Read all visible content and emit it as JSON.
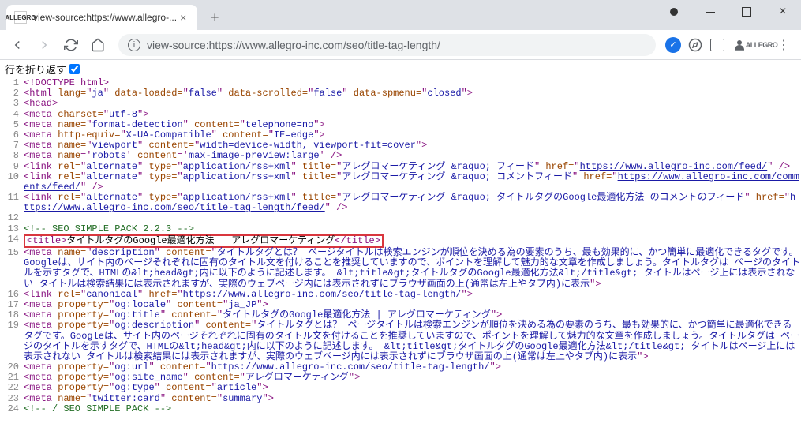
{
  "window": {
    "tab_title": "view-source:https://www.allegro-...",
    "url": "view-source:https://www.allegro-inc.com/seo/title-tag-length/",
    "favicon_text": "ALLEGRO"
  },
  "wrap_label": "行を折り返す",
  "lines": [
    {
      "n": 1,
      "parts": [
        {
          "c": "t",
          "t": "<!DOCTYPE html>"
        }
      ]
    },
    {
      "n": 2,
      "parts": [
        {
          "c": "t",
          "t": "<html "
        },
        {
          "c": "a",
          "t": "lang="
        },
        {
          "c": "t",
          "t": "\""
        },
        {
          "c": "v",
          "t": "ja"
        },
        {
          "c": "t",
          "t": "\" "
        },
        {
          "c": "a",
          "t": "data-loaded="
        },
        {
          "c": "t",
          "t": "\""
        },
        {
          "c": "v",
          "t": "false"
        },
        {
          "c": "t",
          "t": "\" "
        },
        {
          "c": "a",
          "t": "data-scrolled="
        },
        {
          "c": "t",
          "t": "\""
        },
        {
          "c": "v",
          "t": "false"
        },
        {
          "c": "t",
          "t": "\" "
        },
        {
          "c": "a",
          "t": "data-spmenu="
        },
        {
          "c": "t",
          "t": "\""
        },
        {
          "c": "v",
          "t": "closed"
        },
        {
          "c": "t",
          "t": "\">"
        }
      ]
    },
    {
      "n": 3,
      "parts": [
        {
          "c": "t",
          "t": "<head>"
        }
      ]
    },
    {
      "n": 4,
      "parts": [
        {
          "c": "t",
          "t": "<meta "
        },
        {
          "c": "a",
          "t": "charset="
        },
        {
          "c": "t",
          "t": "\""
        },
        {
          "c": "v",
          "t": "utf-8"
        },
        {
          "c": "t",
          "t": "\">"
        }
      ]
    },
    {
      "n": 5,
      "parts": [
        {
          "c": "t",
          "t": "<meta "
        },
        {
          "c": "a",
          "t": "name="
        },
        {
          "c": "t",
          "t": "\""
        },
        {
          "c": "v",
          "t": "format-detection"
        },
        {
          "c": "t",
          "t": "\" "
        },
        {
          "c": "a",
          "t": "content="
        },
        {
          "c": "t",
          "t": "\""
        },
        {
          "c": "v",
          "t": "telephone=no"
        },
        {
          "c": "t",
          "t": "\">"
        }
      ]
    },
    {
      "n": 6,
      "parts": [
        {
          "c": "t",
          "t": "<meta "
        },
        {
          "c": "a",
          "t": "http-equiv="
        },
        {
          "c": "t",
          "t": "\""
        },
        {
          "c": "v",
          "t": "X-UA-Compatible"
        },
        {
          "c": "t",
          "t": "\" "
        },
        {
          "c": "a",
          "t": "content="
        },
        {
          "c": "t",
          "t": "\""
        },
        {
          "c": "v",
          "t": "IE=edge"
        },
        {
          "c": "t",
          "t": "\">"
        }
      ]
    },
    {
      "n": 7,
      "parts": [
        {
          "c": "t",
          "t": "<meta "
        },
        {
          "c": "a",
          "t": "name="
        },
        {
          "c": "t",
          "t": "\""
        },
        {
          "c": "v",
          "t": "viewport"
        },
        {
          "c": "t",
          "t": "\" "
        },
        {
          "c": "a",
          "t": "content="
        },
        {
          "c": "t",
          "t": "\""
        },
        {
          "c": "v",
          "t": "width=device-width, viewport-fit=cover"
        },
        {
          "c": "t",
          "t": "\">"
        }
      ]
    },
    {
      "n": 8,
      "parts": [
        {
          "c": "t",
          "t": "<meta "
        },
        {
          "c": "a",
          "t": "name"
        },
        {
          "c": "t",
          "t": "='"
        },
        {
          "c": "v",
          "t": "robots"
        },
        {
          "c": "t",
          "t": "' "
        },
        {
          "c": "a",
          "t": "content"
        },
        {
          "c": "t",
          "t": "='"
        },
        {
          "c": "v",
          "t": "max-image-preview:large"
        },
        {
          "c": "t",
          "t": "' />"
        }
      ]
    },
    {
      "n": 9,
      "parts": [
        {
          "c": "t",
          "t": "<link "
        },
        {
          "c": "a",
          "t": "rel="
        },
        {
          "c": "t",
          "t": "\""
        },
        {
          "c": "v",
          "t": "alternate"
        },
        {
          "c": "t",
          "t": "\" "
        },
        {
          "c": "a",
          "t": "type="
        },
        {
          "c": "t",
          "t": "\""
        },
        {
          "c": "v",
          "t": "application/rss+xml"
        },
        {
          "c": "t",
          "t": "\" "
        },
        {
          "c": "a",
          "t": "title="
        },
        {
          "c": "t",
          "t": "\""
        },
        {
          "c": "v",
          "t": "アレグロマーケティング &raquo; フィード"
        },
        {
          "c": "t",
          "t": "\" "
        },
        {
          "c": "a",
          "t": "href="
        },
        {
          "c": "t",
          "t": "\""
        },
        {
          "c": "lk",
          "t": "https://www.allegro-inc.com/feed/"
        },
        {
          "c": "t",
          "t": "\" />"
        }
      ]
    },
    {
      "n": 10,
      "parts": [
        {
          "c": "t",
          "t": "<link "
        },
        {
          "c": "a",
          "t": "rel="
        },
        {
          "c": "t",
          "t": "\""
        },
        {
          "c": "v",
          "t": "alternate"
        },
        {
          "c": "t",
          "t": "\" "
        },
        {
          "c": "a",
          "t": "type="
        },
        {
          "c": "t",
          "t": "\""
        },
        {
          "c": "v",
          "t": "application/rss+xml"
        },
        {
          "c": "t",
          "t": "\" "
        },
        {
          "c": "a",
          "t": "title="
        },
        {
          "c": "t",
          "t": "\""
        },
        {
          "c": "v",
          "t": "アレグロマーケティング &raquo; コメントフィード"
        },
        {
          "c": "t",
          "t": "\" "
        },
        {
          "c": "a",
          "t": "href="
        },
        {
          "c": "t",
          "t": "\""
        },
        {
          "c": "lk",
          "t": "https://www.allegro-inc.com/comments/feed/"
        },
        {
          "c": "t",
          "t": "\" />"
        }
      ]
    },
    {
      "n": 11,
      "parts": [
        {
          "c": "t",
          "t": "<link "
        },
        {
          "c": "a",
          "t": "rel="
        },
        {
          "c": "t",
          "t": "\""
        },
        {
          "c": "v",
          "t": "alternate"
        },
        {
          "c": "t",
          "t": "\" "
        },
        {
          "c": "a",
          "t": "type="
        },
        {
          "c": "t",
          "t": "\""
        },
        {
          "c": "v",
          "t": "application/rss+xml"
        },
        {
          "c": "t",
          "t": "\" "
        },
        {
          "c": "a",
          "t": "title="
        },
        {
          "c": "t",
          "t": "\""
        },
        {
          "c": "v",
          "t": "アレグロマーケティング &raquo; タイトルタグのGoogle最適化方法 のコメントのフィード"
        },
        {
          "c": "t",
          "t": "\" "
        },
        {
          "c": "a",
          "t": "href="
        },
        {
          "c": "t",
          "t": "\""
        },
        {
          "c": "lk",
          "t": "https://www.allegro-inc.com/seo/title-tag-length/feed/"
        },
        {
          "c": "t",
          "t": "\" />"
        }
      ]
    },
    {
      "n": 12,
      "parts": []
    },
    {
      "n": 13,
      "parts": [
        {
          "c": "c",
          "t": "<!-- SEO SIMPLE PACK 2.2.3 -->"
        }
      ]
    },
    {
      "n": 14,
      "highlight": true,
      "parts": [
        {
          "c": "t",
          "t": "<title>"
        },
        {
          "c": "plain",
          "t": "タイトルタグのGoogle最適化方法 | アレグロマーケティング"
        },
        {
          "c": "t",
          "t": "</title>"
        }
      ]
    },
    {
      "n": 15,
      "parts": [
        {
          "c": "t",
          "t": "<meta "
        },
        {
          "c": "a",
          "t": "name="
        },
        {
          "c": "t",
          "t": "\""
        },
        {
          "c": "v",
          "t": "description"
        },
        {
          "c": "t",
          "t": "\" "
        },
        {
          "c": "a",
          "t": "content="
        },
        {
          "c": "t",
          "t": "\""
        },
        {
          "c": "v",
          "t": "タイトルタグとは？ ページタイトルは検索エンジンが順位を決める為の要素のうち、最も効果的に、かつ簡単に最適化できるタグです。Googleは、サイト内のページそれぞれに固有のタイトル文を付けることを推奨していますので、ポイントを理解して魅力的な文章を作成しましょう。タイトルタグは ページのタイトルを示すタグで、HTMLの&lt;head&gt;内に以下のように記述します。 &lt;title&gt;タイトルタグのGoogle最適化方法&lt;/title&gt; タイトルはページ上には表示されない タイトルは検索結果には表示されますが、実際のウェブページ内には表示されずにブラウザ画面の上(通常は左上やタブ内)に表示"
        },
        {
          "c": "t",
          "t": "\">"
        }
      ]
    },
    {
      "n": 16,
      "parts": [
        {
          "c": "t",
          "t": "<link "
        },
        {
          "c": "a",
          "t": "rel="
        },
        {
          "c": "t",
          "t": "\""
        },
        {
          "c": "v",
          "t": "canonical"
        },
        {
          "c": "t",
          "t": "\" "
        },
        {
          "c": "a",
          "t": "href="
        },
        {
          "c": "t",
          "t": "\""
        },
        {
          "c": "lk",
          "t": "https://www.allegro-inc.com/seo/title-tag-length/"
        },
        {
          "c": "t",
          "t": "\">"
        }
      ]
    },
    {
      "n": 17,
      "parts": [
        {
          "c": "t",
          "t": "<meta "
        },
        {
          "c": "a",
          "t": "property="
        },
        {
          "c": "t",
          "t": "\""
        },
        {
          "c": "v",
          "t": "og:locale"
        },
        {
          "c": "t",
          "t": "\" "
        },
        {
          "c": "a",
          "t": "content="
        },
        {
          "c": "t",
          "t": "\""
        },
        {
          "c": "v",
          "t": "ja_JP"
        },
        {
          "c": "t",
          "t": "\">"
        }
      ]
    },
    {
      "n": 18,
      "parts": [
        {
          "c": "t",
          "t": "<meta "
        },
        {
          "c": "a",
          "t": "property="
        },
        {
          "c": "t",
          "t": "\""
        },
        {
          "c": "v",
          "t": "og:title"
        },
        {
          "c": "t",
          "t": "\" "
        },
        {
          "c": "a",
          "t": "content="
        },
        {
          "c": "t",
          "t": "\""
        },
        {
          "c": "v",
          "t": "タイトルタグのGoogle最適化方法 | アレグロマーケティング"
        },
        {
          "c": "t",
          "t": "\">"
        }
      ]
    },
    {
      "n": 19,
      "parts": [
        {
          "c": "t",
          "t": "<meta "
        },
        {
          "c": "a",
          "t": "property="
        },
        {
          "c": "t",
          "t": "\""
        },
        {
          "c": "v",
          "t": "og:description"
        },
        {
          "c": "t",
          "t": "\" "
        },
        {
          "c": "a",
          "t": "content="
        },
        {
          "c": "t",
          "t": "\""
        },
        {
          "c": "v",
          "t": "タイトルタグとは？ ページタイトルは検索エンジンが順位を決める為の要素のうち、最も効果的に、かつ簡単に最適化できるタグです。Googleは、サイト内のページそれぞれに固有のタイトル文を付けることを推奨していますので、ポイントを理解して魅力的な文章を作成しましょう。タイトルタグは ページのタイトルを示すタグで、HTMLの&lt;head&gt;内に以下のように記述します。 &lt;title&gt;タイトルタグのGoogle最適化方法&lt;/title&gt; タイトルはページ上には表示されない タイトルは検索結果には表示されますが、実際のウェブページ内には表示されずにブラウザ画面の上(通常は左上やタブ内)に表示"
        },
        {
          "c": "t",
          "t": "\">"
        }
      ]
    },
    {
      "n": 20,
      "parts": [
        {
          "c": "t",
          "t": "<meta "
        },
        {
          "c": "a",
          "t": "property="
        },
        {
          "c": "t",
          "t": "\""
        },
        {
          "c": "v",
          "t": "og:url"
        },
        {
          "c": "t",
          "t": "\" "
        },
        {
          "c": "a",
          "t": "content="
        },
        {
          "c": "t",
          "t": "\""
        },
        {
          "c": "v",
          "t": "https://www.allegro-inc.com/seo/title-tag-length/"
        },
        {
          "c": "t",
          "t": "\">"
        }
      ]
    },
    {
      "n": 21,
      "parts": [
        {
          "c": "t",
          "t": "<meta "
        },
        {
          "c": "a",
          "t": "property="
        },
        {
          "c": "t",
          "t": "\""
        },
        {
          "c": "v",
          "t": "og:site_name"
        },
        {
          "c": "t",
          "t": "\" "
        },
        {
          "c": "a",
          "t": "content="
        },
        {
          "c": "t",
          "t": "\""
        },
        {
          "c": "v",
          "t": "アレグロマーケティング"
        },
        {
          "c": "t",
          "t": "\">"
        }
      ]
    },
    {
      "n": 22,
      "parts": [
        {
          "c": "t",
          "t": "<meta "
        },
        {
          "c": "a",
          "t": "property="
        },
        {
          "c": "t",
          "t": "\""
        },
        {
          "c": "v",
          "t": "og:type"
        },
        {
          "c": "t",
          "t": "\" "
        },
        {
          "c": "a",
          "t": "content="
        },
        {
          "c": "t",
          "t": "\""
        },
        {
          "c": "v",
          "t": "article"
        },
        {
          "c": "t",
          "t": "\">"
        }
      ]
    },
    {
      "n": 23,
      "parts": [
        {
          "c": "t",
          "t": "<meta "
        },
        {
          "c": "a",
          "t": "name="
        },
        {
          "c": "t",
          "t": "\""
        },
        {
          "c": "v",
          "t": "twitter:card"
        },
        {
          "c": "t",
          "t": "\" "
        },
        {
          "c": "a",
          "t": "content="
        },
        {
          "c": "t",
          "t": "\""
        },
        {
          "c": "v",
          "t": "summary"
        },
        {
          "c": "t",
          "t": "\">"
        }
      ]
    },
    {
      "n": 24,
      "parts": [
        {
          "c": "c",
          "t": "<!-- / SEO SIMPLE PACK -->"
        }
      ]
    }
  ]
}
